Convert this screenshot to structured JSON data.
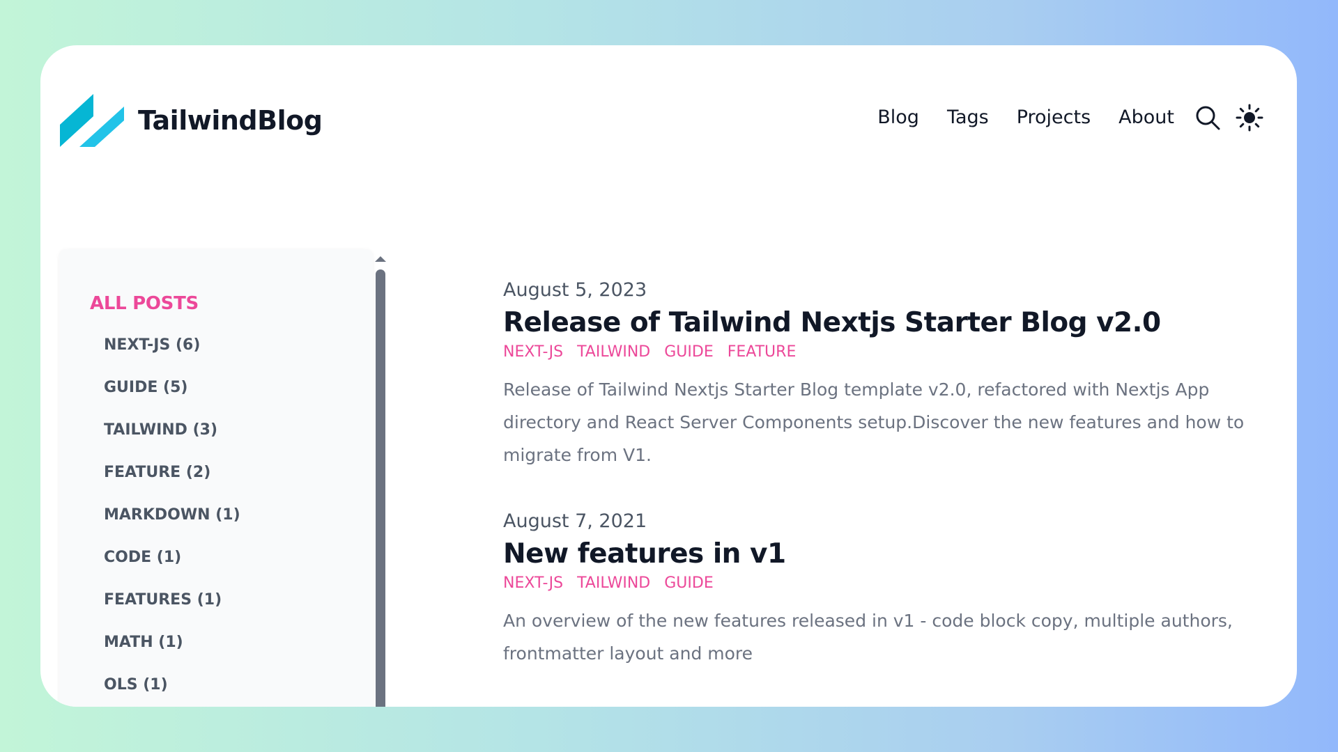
{
  "header": {
    "site_title": "TailwindBlog",
    "logo_icon": "logo-stripes-icon",
    "logo_colors": [
      "#06b6d4",
      "#67e8f9"
    ],
    "nav": [
      "Blog",
      "Tags",
      "Projects",
      "About"
    ],
    "search_icon": "search-icon",
    "theme_icon": "sun-icon"
  },
  "sidebar": {
    "all_posts_label": "ALL POSTS",
    "tags": [
      "NEXT-JS (6)",
      "GUIDE (5)",
      "TAILWIND (3)",
      "FEATURE (2)",
      "MARKDOWN (1)",
      "CODE (1)",
      "FEATURES (1)",
      "MATH (1)",
      "OLS (1)"
    ]
  },
  "posts": [
    {
      "date": "August 5, 2023",
      "title": "Release of Tailwind Nextjs Starter Blog v2.0",
      "tags": [
        "NEXT-JS",
        "TAILWIND",
        "GUIDE",
        "FEATURE"
      ],
      "summary": "Release of Tailwind Nextjs Starter Blog template v2.0, refactored with Nextjs App directory and React Server Components setup.Discover the new features and how to migrate from V1."
    },
    {
      "date": "August 7, 2021",
      "title": "New features in v1",
      "tags": [
        "NEXT-JS",
        "TAILWIND",
        "GUIDE"
      ],
      "summary": "An overview of the new features released in v1 - code block copy, multiple authors, frontmatter layout and more"
    }
  ],
  "colors": {
    "accent": "#ec4899",
    "text": "#111827",
    "muted": "#6b7280"
  }
}
